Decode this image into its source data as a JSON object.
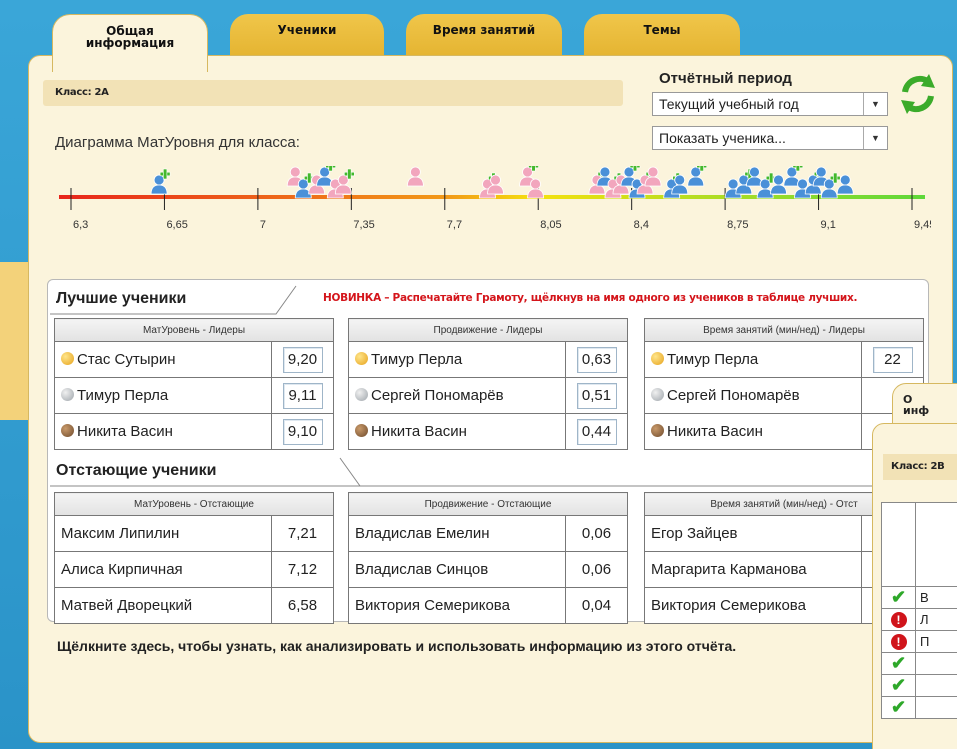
{
  "tabs": [
    {
      "label": "Общая\nинформация",
      "active": true
    },
    {
      "label": "Ученики",
      "active": false
    },
    {
      "label": "Время занятий",
      "active": false
    },
    {
      "label": "Темы",
      "active": false
    }
  ],
  "class_label": "Класс: 2А",
  "period": {
    "label": "Отчётный период",
    "selected": "Текущий учебный год",
    "student_select": "Показать ученика..."
  },
  "chart": {
    "title": "Диаграмма МатУровня для класса:",
    "ticks": [
      "6,3",
      "6,65",
      "7",
      "7,35",
      "7,7",
      "8,05",
      "8,4",
      "8,75",
      "9,1",
      "9,45"
    ],
    "colors": {
      "low": "#e8251b",
      "mid": "#f5e10f",
      "high": "#5dd83a",
      "pink": "#f2a6bd",
      "blue": "#4a90d8",
      "plus": "#44b82c"
    }
  },
  "chart_data": {
    "type": "scatter",
    "x": [
      6.63,
      7.14,
      7.17,
      7.22,
      7.25,
      7.29,
      7.32,
      7.59,
      7.86,
      7.89,
      8.01,
      8.04,
      8.27,
      8.3,
      8.33,
      8.36,
      8.39,
      8.42,
      8.45,
      8.48,
      8.55,
      8.58,
      8.64,
      8.78,
      8.82,
      8.86,
      8.9,
      8.95,
      9.0,
      9.04,
      9.08,
      9.11,
      9.14,
      9.2
    ],
    "groups": [
      "blue",
      "pink",
      "blue",
      "pink",
      "blue",
      "pink",
      "pink",
      "pink",
      "pink",
      "pink",
      "pink",
      "pink",
      "pink",
      "blue",
      "pink",
      "pink",
      "blue",
      "blue",
      "pink",
      "pink",
      "blue",
      "blue",
      "blue",
      "blue",
      "blue",
      "blue",
      "blue",
      "blue",
      "blue",
      "blue",
      "blue",
      "blue",
      "blue",
      "blue"
    ],
    "xlim": [
      6.3,
      9.45
    ],
    "xticks": [
      "6,3",
      "6,65",
      "7",
      "7,35",
      "7,7",
      "8,05",
      "8,4",
      "8,75",
      "9,1",
      "9,45"
    ]
  },
  "best": {
    "title": "Лучшие ученики",
    "news": "НОВИНКА – Распечатайте Грамоту, щёлкнув на имя одного из учеников в таблице лучших.",
    "tables": [
      {
        "header": "МатУровень - Лидеры",
        "rows": [
          {
            "name": "Стас Сутырин",
            "value": "9,20",
            "medal": "gold"
          },
          {
            "name": "Тимур Перла",
            "value": "9,11",
            "medal": "silver"
          },
          {
            "name": "Никита Васин",
            "value": "9,10",
            "medal": "bronze"
          }
        ]
      },
      {
        "header": "Продвижение - Лидеры",
        "rows": [
          {
            "name": "Тимур Перла",
            "value": "0,63",
            "medal": "gold"
          },
          {
            "name": "Сергей Пономарёв",
            "value": "0,51",
            "medal": "silver"
          },
          {
            "name": "Никита Васин",
            "value": "0,44",
            "medal": "bronze"
          }
        ]
      },
      {
        "header": "Время занятий (мин/нед) - Лидеры",
        "rows": [
          {
            "name": "Тимур Перла",
            "value": "22",
            "medal": "gold"
          },
          {
            "name": "Сергей Пономарёв",
            "value": "",
            "medal": "silver"
          },
          {
            "name": "Никита Васин",
            "value": "",
            "medal": "bronze"
          }
        ]
      }
    ]
  },
  "lagging": {
    "title": "Отстающие ученики",
    "tables": [
      {
        "header": "МатУровень - Отстающие",
        "rows": [
          {
            "name": "Максим Липилин",
            "value": "7,21"
          },
          {
            "name": "Алиса Кирпичная",
            "value": "7,12"
          },
          {
            "name": "Матвей Дворецкий",
            "value": "6,58"
          }
        ]
      },
      {
        "header": "Продвижение - Отстающие",
        "rows": [
          {
            "name": "Владислав Емелин",
            "value": "0,06"
          },
          {
            "name": "Владислав Синцов",
            "value": "0,06"
          },
          {
            "name": "Виктория Семерикова",
            "value": "0,04"
          }
        ]
      },
      {
        "header": "Время занятий (мин/нед) - Отст",
        "rows": [
          {
            "name": "Егор Зайцев",
            "value": ""
          },
          {
            "name": "Маргарита Карманова",
            "value": ""
          },
          {
            "name": "Виктория Семерикова",
            "value": ""
          }
        ]
      }
    ]
  },
  "footer_link": "Щёлкните здесь, чтобы узнать, как анализировать и использовать информацию из этого отчёта.",
  "window2": {
    "tab_label": "О\nинф",
    "class_label": "Класс: 2В",
    "rows": [
      {
        "status": "ok",
        "text": "В"
      },
      {
        "status": "warn",
        "text": "Л"
      },
      {
        "status": "warn",
        "text": "П"
      },
      {
        "status": "ok",
        "text": ""
      },
      {
        "status": "ok",
        "text": ""
      },
      {
        "status": "ok",
        "text": ""
      }
    ]
  }
}
